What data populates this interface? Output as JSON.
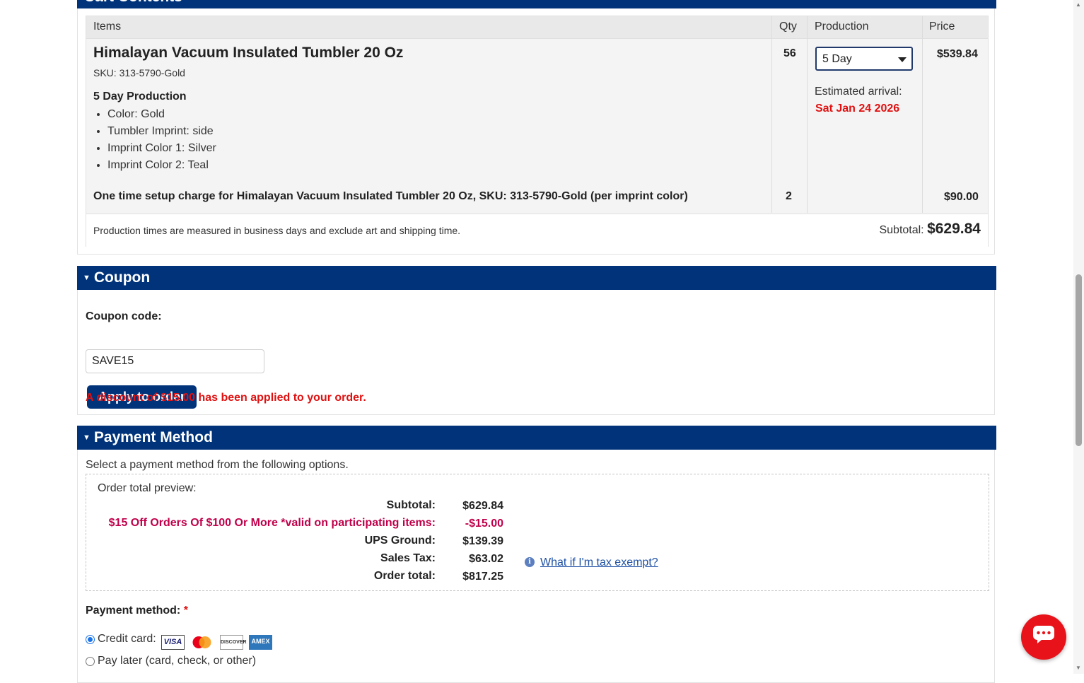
{
  "cart": {
    "section_title": "Cart Contents",
    "headers": {
      "items": "Items",
      "qty": "Qty",
      "production": "Production",
      "price": "Price"
    },
    "product": {
      "title": "Himalayan Vacuum Insulated Tumbler 20 Oz",
      "sku": "SKU: 313-5790-Gold",
      "production_label": "5 Day Production",
      "options": [
        "Color: Gold",
        "Tumbler Imprint: side",
        "Imprint Color 1: Silver",
        "Imprint Color 2: Teal"
      ],
      "qty": "56",
      "production_select": "5 Day",
      "estimated_label": "Estimated arrival:",
      "estimated_date": "Sat Jan 24 2026",
      "price": "$539.84"
    },
    "setup": {
      "label": "One time setup charge for Himalayan Vacuum Insulated Tumbler 20 Oz, SKU: 313-5790-Gold (per imprint color)",
      "qty": "2",
      "price": "$90.00"
    },
    "footnote": "Production times are measured in business days and exclude art and shipping time.",
    "subtotal_label": "Subtotal:",
    "subtotal_value": "$629.84"
  },
  "coupon": {
    "section_title": "Coupon",
    "label": "Coupon code:",
    "value": "SAVE15",
    "apply_button": "Apply to order",
    "message": "A discount of $15.00 has been applied to your order."
  },
  "payment": {
    "section_title": "Payment Method",
    "intro": "Select a payment method from the following options.",
    "preview_label": "Order total preview:",
    "rows": [
      {
        "label": "Subtotal:",
        "value": "$629.84"
      },
      {
        "label": "$15 Off Orders Of $100 Or More *valid on participating items:",
        "value": "-$15.00"
      },
      {
        "label": "UPS Ground:",
        "value": "$139.39"
      },
      {
        "label": "Sales Tax:",
        "value": "$63.02"
      },
      {
        "label": "Order total:",
        "value": "$817.25"
      }
    ],
    "tax_link": "What if I'm tax exempt?",
    "method_label": "Payment method:",
    "required_mark": "*",
    "option_credit": "Credit card:",
    "option_later": "Pay later (card, check, or other)",
    "cards": [
      "VISA",
      "MasterCard",
      "DISCOVER",
      "AMEX"
    ]
  },
  "colors": {
    "brand": "#00337a",
    "alert": "#e01010",
    "promo": "#c0004a",
    "chat": "#e8131a"
  }
}
